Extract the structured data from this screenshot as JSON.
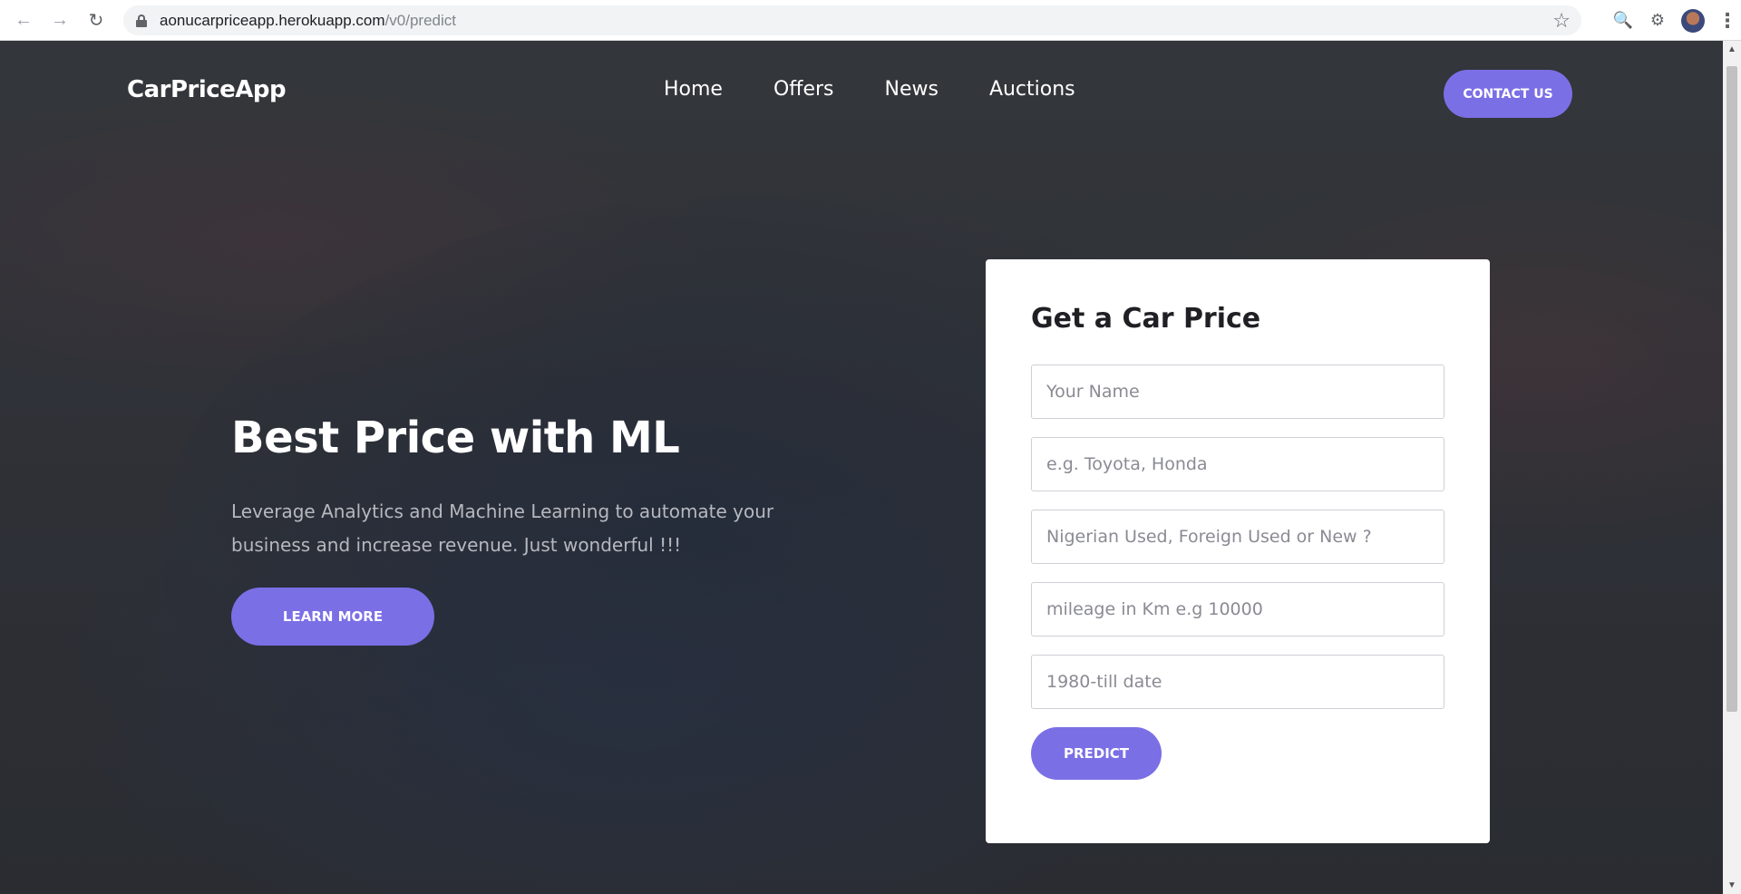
{
  "browser": {
    "url_host": "aonucarpriceapp.herokuapp.com",
    "url_path": "/v0/predict",
    "icons": [
      "back-arrow-icon",
      "forward-arrow-icon",
      "reload-icon",
      "lock-icon",
      "star-icon",
      "search-extension-icon",
      "puzzle-icon",
      "avatar",
      "menu-dots-icon"
    ]
  },
  "header": {
    "logo": "CarPriceApp",
    "nav": [
      "Home",
      "Offers",
      "News",
      "Auctions"
    ],
    "contact_label": "CONTACT US"
  },
  "hero": {
    "title": "Best Price with ML",
    "subtitle": "Leverage Analytics and Machine Learning to automate your business and increase revenue. Just wonderful !!!",
    "learn_more_label": "LEARN MORE"
  },
  "form": {
    "title": "Get a Car Price",
    "fields": [
      {
        "placeholder": "Your Name",
        "value": ""
      },
      {
        "placeholder": "e.g. Toyota, Honda",
        "value": ""
      },
      {
        "placeholder": "Nigerian Used, Foreign Used or New ?",
        "value": ""
      },
      {
        "placeholder": "mileage in Km e.g 10000",
        "value": ""
      },
      {
        "placeholder": "1980-till date",
        "value": ""
      }
    ],
    "predict_label": "PREDICT"
  },
  "colors": {
    "accent": "#7b6fe6",
    "hero_bg": "#34363c",
    "card_bg": "#ffffff"
  }
}
